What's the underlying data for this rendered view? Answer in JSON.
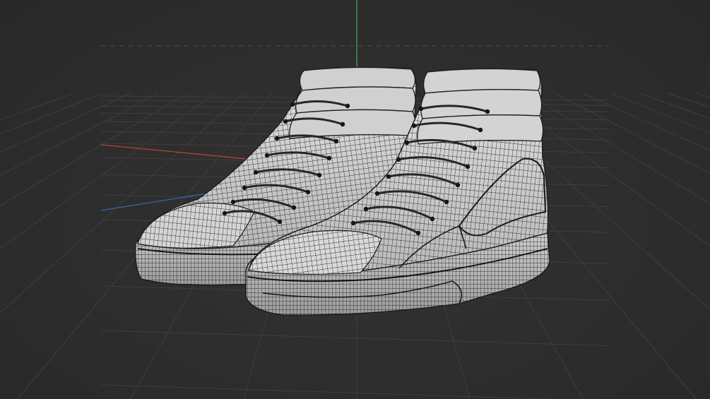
{
  "viewport": {
    "background_color": "#2c2c2c",
    "grid_color": "#3e3e3e",
    "shading": "wireframe-on-shaded",
    "axis_colors": {
      "x": "#b9443f",
      "y": "#3bab52",
      "z": "#3f67b5"
    }
  },
  "scene": {
    "objects": [
      {
        "kind": "high-top sneaker",
        "side": "left",
        "surface_color": "#d4d4d4",
        "wire_color": "#1e1e1e"
      },
      {
        "kind": "high-top sneaker",
        "side": "right",
        "surface_color": "#d9d9d9",
        "wire_color": "#1e1e1e"
      }
    ]
  }
}
